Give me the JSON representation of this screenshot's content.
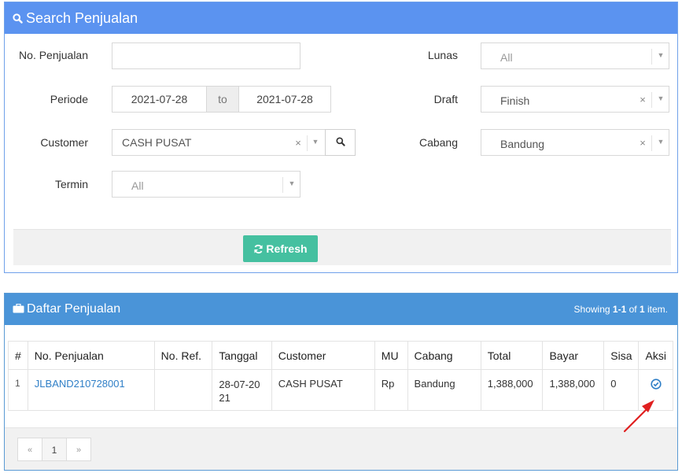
{
  "search": {
    "title": "Search Penjualan",
    "labels": {
      "no_penjualan": "No. Penjualan",
      "periode": "Periode",
      "customer": "Customer",
      "termin": "Termin",
      "lunas": "Lunas",
      "draft": "Draft",
      "cabang": "Cabang"
    },
    "fields": {
      "no_penjualan": "",
      "periode_from": "2021-07-28",
      "periode_to_label": "to",
      "periode_to": "2021-07-28",
      "customer": "CASH PUSAT",
      "termin": "All",
      "lunas": "All",
      "draft": "Finish",
      "cabang": "Bandung"
    },
    "refresh_label": "Refresh"
  },
  "list": {
    "title": "Daftar Penjualan",
    "summary_prefix": "Showing",
    "summary_range": "1-1",
    "summary_of": "of",
    "summary_total": "1",
    "summary_suffix": "item.",
    "columns": [
      "#",
      "No. Penjualan",
      "No. Ref.",
      "Tanggal",
      "Customer",
      "MU",
      "Cabang",
      "Total",
      "Bayar",
      "Sisa",
      "Aksi"
    ],
    "rows": [
      {
        "index": "1",
        "no_penjualan": "JLBAND210728001",
        "no_ref": "",
        "tanggal": "28-07-2021",
        "customer": "CASH PUSAT",
        "mu": "Rp",
        "cabang": "Bandung",
        "total": "1,388,000",
        "bayar": "1,388,000",
        "sisa": "0"
      }
    ],
    "pager": {
      "prev": "«",
      "current": "1",
      "next": "»"
    }
  },
  "colors": {
    "search_header": "#5b93f0",
    "list_header": "#4a94d8",
    "refresh_button": "#45c0a0",
    "link": "#2f7fc7",
    "annotation_arrow": "#e02020"
  },
  "icons": {
    "search_header": "search-icon",
    "list_header": "briefcase-icon",
    "refresh": "refresh-icon",
    "customer_lookup": "search-icon",
    "aksi": "check-circle-icon"
  }
}
